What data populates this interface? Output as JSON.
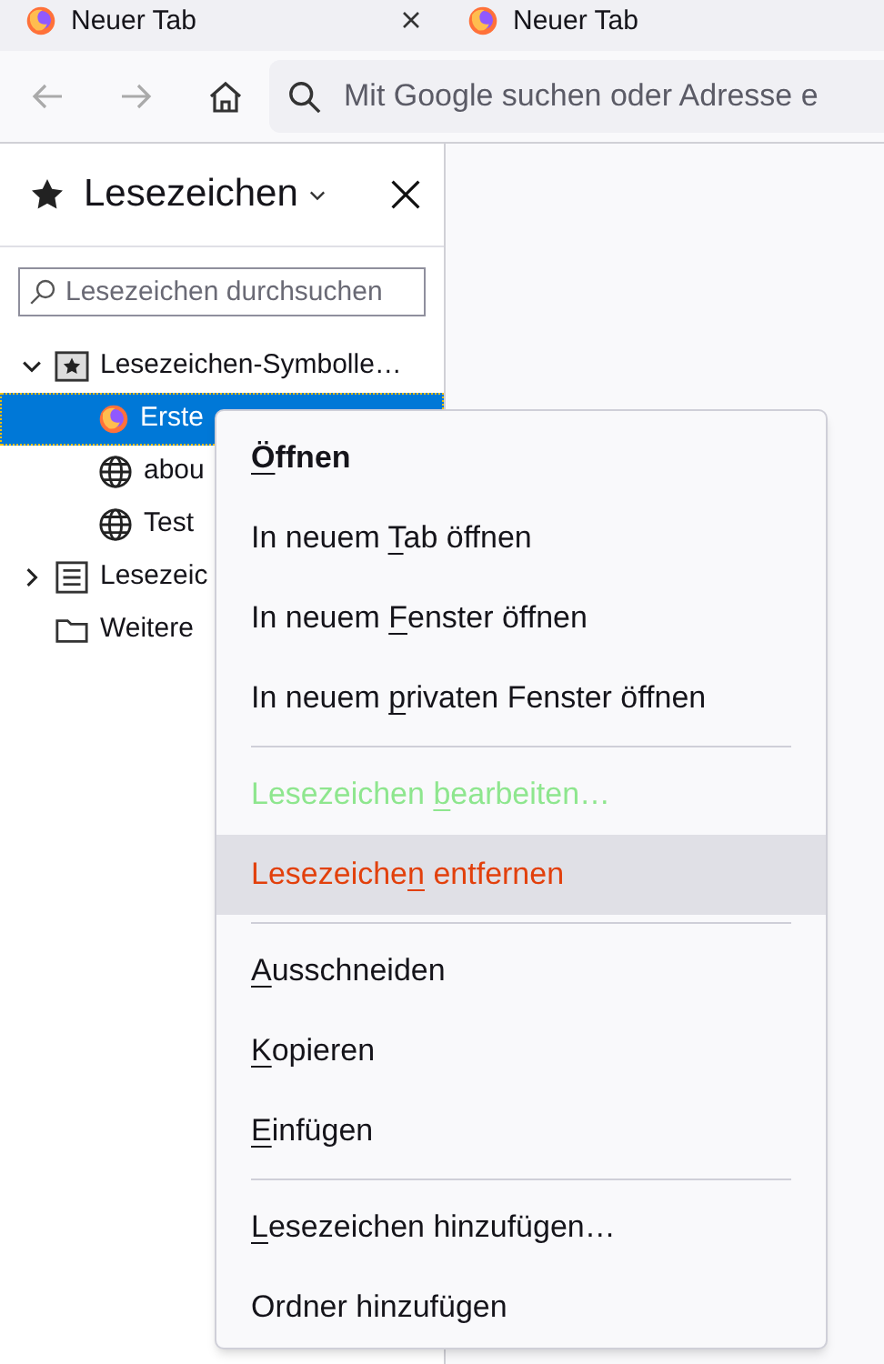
{
  "tabs": [
    {
      "title": "Neuer Tab",
      "closable": true
    },
    {
      "title": "Neuer Tab",
      "closable": false
    }
  ],
  "toolbar": {
    "url_placeholder": "Mit Google suchen oder Adresse e"
  },
  "sidebar": {
    "title": "Lesezeichen",
    "search_placeholder": "Lesezeichen durchsuchen",
    "tree": [
      {
        "label": "Lesezeichen-Symbolle…",
        "kind": "toolbar",
        "expanded": true,
        "selected": false,
        "children": [
          {
            "label": "Erste",
            "kind": "firefox",
            "selected": true
          },
          {
            "label": "abou",
            "kind": "globe",
            "selected": false
          },
          {
            "label": "Test",
            "kind": "globe",
            "selected": false
          }
        ]
      },
      {
        "label": "Lesezeic",
        "kind": "menu",
        "expanded": false,
        "selected": false
      },
      {
        "label": "Weitere",
        "kind": "folder",
        "selected": false
      }
    ]
  },
  "context_menu": [
    {
      "kind": "item",
      "key": "Ö",
      "post": "ffnen",
      "bold": true,
      "disabled": false,
      "selected": false
    },
    {
      "kind": "item",
      "pre": "In neuem ",
      "key": "T",
      "post": "ab öffnen",
      "bold": false,
      "disabled": false,
      "selected": false
    },
    {
      "kind": "item",
      "pre": "In neuem ",
      "key": "F",
      "post": "enster öffnen",
      "bold": false,
      "disabled": false,
      "selected": false
    },
    {
      "kind": "item",
      "pre": "In neuem ",
      "key": "p",
      "post": "rivaten Fenster öffnen",
      "bold": false,
      "disabled": false,
      "selected": false
    },
    {
      "kind": "separator"
    },
    {
      "kind": "item",
      "pre": "Lesezeichen ",
      "key": "b",
      "post": "earbeiten…",
      "bold": false,
      "disabled": true,
      "selected": false
    },
    {
      "kind": "item",
      "pre": "Lesezeiche",
      "key": "n",
      "post": " entfernen",
      "bold": false,
      "disabled": false,
      "selected": true
    },
    {
      "kind": "separator"
    },
    {
      "kind": "item",
      "key": "A",
      "post": "usschneiden",
      "bold": false,
      "disabled": false,
      "selected": false
    },
    {
      "kind": "item",
      "key": "K",
      "post": "opieren",
      "bold": false,
      "disabled": false,
      "selected": false
    },
    {
      "kind": "item",
      "key": "E",
      "post": "infügen",
      "bold": false,
      "disabled": false,
      "selected": false
    },
    {
      "kind": "separator"
    },
    {
      "kind": "item",
      "key": "L",
      "post": "esezeichen hinzufügen…",
      "bold": false,
      "disabled": false,
      "selected": false
    },
    {
      "kind": "item",
      "post": "Ordner hinzufügen",
      "bold": false,
      "disabled": false,
      "selected": false
    }
  ]
}
